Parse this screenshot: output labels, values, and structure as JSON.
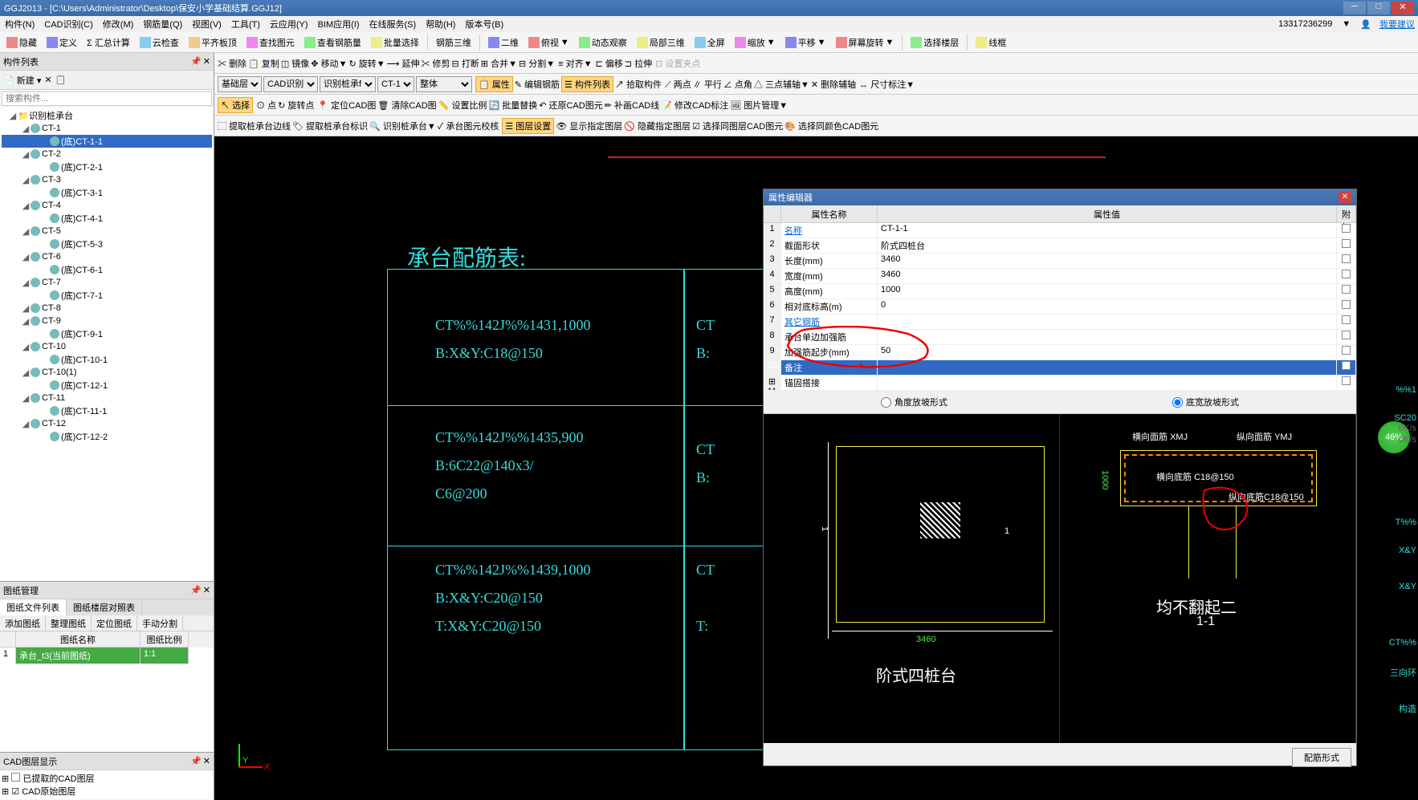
{
  "window": {
    "title": "GGJ2013 - [C:\\Users\\Administrator\\Desktop\\保安小学基础结算.GGJ12]"
  },
  "menu": {
    "items": [
      "构件(N)",
      "CAD识别(C)",
      "修改(M)",
      "钢筋量(Q)",
      "视图(V)",
      "工具(T)",
      "云应用(Y)",
      "BIM应用(I)",
      "在线服务(S)",
      "帮助(H)",
      "版本号(B)"
    ],
    "phone": "13317236299",
    "suggest": "我要建议"
  },
  "toolbar1": {
    "items": [
      "隐藏",
      "定义",
      "Σ 汇总计算",
      "云检查",
      "平齐板顶",
      "查找图元",
      "查看钢筋量",
      "批量选择",
      "钢筋三维",
      "二维",
      "俯视",
      "动态观察",
      "局部三维",
      "全屏",
      "缩放",
      "平移",
      "屏幕旋转",
      "选择楼层",
      "线框"
    ]
  },
  "toolbar2": {
    "items": [
      "删除",
      "复制",
      "镜像",
      "移动",
      "旋转",
      "延伸",
      "修剪",
      "打断",
      "合并",
      "分割",
      "对齐",
      "偏移",
      "拉伸",
      "设置夹点"
    ]
  },
  "toolbar3": {
    "combos": [
      "基础层",
      "CAD识别",
      "识别桩承f",
      "CT-1",
      "整体"
    ],
    "items": [
      "属性",
      "编辑钢筋",
      "构件列表",
      "拾取构件",
      "两点",
      "平行",
      "点角",
      "三点辅轴",
      "删除辅轴",
      "尺寸标注"
    ]
  },
  "toolbar4": {
    "select": "选择",
    "items": [
      "点",
      "旋转点",
      "定位CAD图",
      "清除CAD图",
      "设置比例",
      "批量替换",
      "还原CAD图元",
      "补画CAD线",
      "修改CAD标注",
      "图片管理"
    ]
  },
  "toolbar5": {
    "items": [
      "提取桩承台边线",
      "提取桩承台标识",
      "识别桩承台",
      "承台图元校核",
      "图层设置",
      "显示指定图层",
      "隐藏指定图层",
      "选择同图层CAD图元",
      "选择同颜色CAD图元"
    ]
  },
  "left_panel": {
    "title": "构件列表",
    "new_btn": "新建",
    "search_placeholder": "搜索构件...",
    "tree": [
      {
        "label": "识别桩承台",
        "level": 0,
        "expanded": true
      },
      {
        "label": "CT-1",
        "level": 1
      },
      {
        "label": "(底)CT-1-1",
        "level": 2,
        "selected": true
      },
      {
        "label": "CT-2",
        "level": 1
      },
      {
        "label": "(底)CT-2-1",
        "level": 2
      },
      {
        "label": "CT-3",
        "level": 1
      },
      {
        "label": "(底)CT-3-1",
        "level": 2
      },
      {
        "label": "CT-4",
        "level": 1
      },
      {
        "label": "(底)CT-4-1",
        "level": 2
      },
      {
        "label": "CT-5",
        "level": 1
      },
      {
        "label": "(底)CT-5-3",
        "level": 2
      },
      {
        "label": "CT-6",
        "level": 1
      },
      {
        "label": "(底)CT-6-1",
        "level": 2
      },
      {
        "label": "CT-7",
        "level": 1
      },
      {
        "label": "(底)CT-7-1",
        "level": 2
      },
      {
        "label": "CT-8",
        "level": 1
      },
      {
        "label": "CT-9",
        "level": 1
      },
      {
        "label": "(底)CT-9-1",
        "level": 2
      },
      {
        "label": "CT-10",
        "level": 1
      },
      {
        "label": "(底)CT-10-1",
        "level": 2
      },
      {
        "label": "CT-10(1)",
        "level": 1
      },
      {
        "label": "(底)CT-12-1",
        "level": 2
      },
      {
        "label": "CT-11",
        "level": 1
      },
      {
        "label": "(底)CT-11-1",
        "level": 2
      },
      {
        "label": "CT-12",
        "level": 1
      },
      {
        "label": "(底)CT-12-2",
        "level": 2
      }
    ]
  },
  "drawing_panel": {
    "title": "图纸管理",
    "tabs": [
      "图纸文件列表",
      "图纸楼层对照表"
    ],
    "toolbar": [
      "添加图纸",
      "整理图纸",
      "定位图纸",
      "手动分割"
    ],
    "headers": [
      "图纸名称",
      "图纸比例"
    ],
    "row": {
      "idx": "1",
      "name": "承台_t3(当前图纸)",
      "scale": "1:1"
    }
  },
  "layer_panel": {
    "title": "CAD图层显示",
    "items": [
      "已提取的CAD图层",
      "CAD原始图层"
    ]
  },
  "cad": {
    "title": "承台配筋表:",
    "rows": [
      [
        "CT%%142J%%1431,1000",
        "B:X&Y:C18@150"
      ],
      [
        "CT%%142J%%1435,900",
        "B:6C22@140x3/",
        "C6@200"
      ],
      [
        "CT%%142J%%1439,1000",
        "B:X&Y:C20@150",
        "T:X&Y:C20@150"
      ]
    ],
    "partial": [
      "CT",
      "B:",
      "CT",
      "B:",
      "CT",
      "T:"
    ],
    "right_partial": [
      "%%1",
      "SC20",
      "T%%",
      "X&Y",
      "X&Y",
      "CT%%",
      "三向环",
      "构造"
    ]
  },
  "property": {
    "title": "属性编辑器",
    "header_name": "属性名称",
    "header_value": "属性值",
    "header_extra": "附加",
    "rows": [
      {
        "idx": "1",
        "name": "名称",
        "value": "CT-1-1",
        "link": true
      },
      {
        "idx": "2",
        "name": "截面形状",
        "value": "阶式四桩台"
      },
      {
        "idx": "3",
        "name": "长度(mm)",
        "value": "3460"
      },
      {
        "idx": "4",
        "name": "宽度(mm)",
        "value": "3460"
      },
      {
        "idx": "5",
        "name": "高度(mm)",
        "value": "1000"
      },
      {
        "idx": "6",
        "name": "相对底标高(m)",
        "value": "0"
      },
      {
        "idx": "7",
        "name": "其它钢筋",
        "value": "",
        "link": true
      },
      {
        "idx": "8",
        "name": "承台单边加强筋",
        "value": ""
      },
      {
        "idx": "9",
        "name": "加强筋起步(mm)",
        "value": "50"
      },
      {
        "idx": "10",
        "name": "备注",
        "value": "",
        "selected": true
      },
      {
        "idx": "11",
        "name": "锚固搭接",
        "value": "",
        "expand": true
      }
    ],
    "radio1": "角度放坡形式",
    "radio2": "底宽放坡形式",
    "diagram1_title": "阶式四桩台",
    "diagram2_title": "均不翻起二",
    "diagram2_sub": "1-1",
    "dim_3460": "3460",
    "dim_1000": "1000",
    "dim_1": "1",
    "lbl_hor_top": "横向面筋",
    "lbl_ver_top": "纵向面筋",
    "lbl_hor_bot": "横向底筋",
    "lbl_ver_bot": "纵向底筋",
    "lbl_c18": "C18@150",
    "lbl_xmj": "XMJ",
    "lbl_ymj": "YMJ",
    "btn_form": "配筋形式"
  },
  "badge": {
    "percent": "46%",
    "speed1": "0K/s",
    "speed2": "0K/s"
  }
}
